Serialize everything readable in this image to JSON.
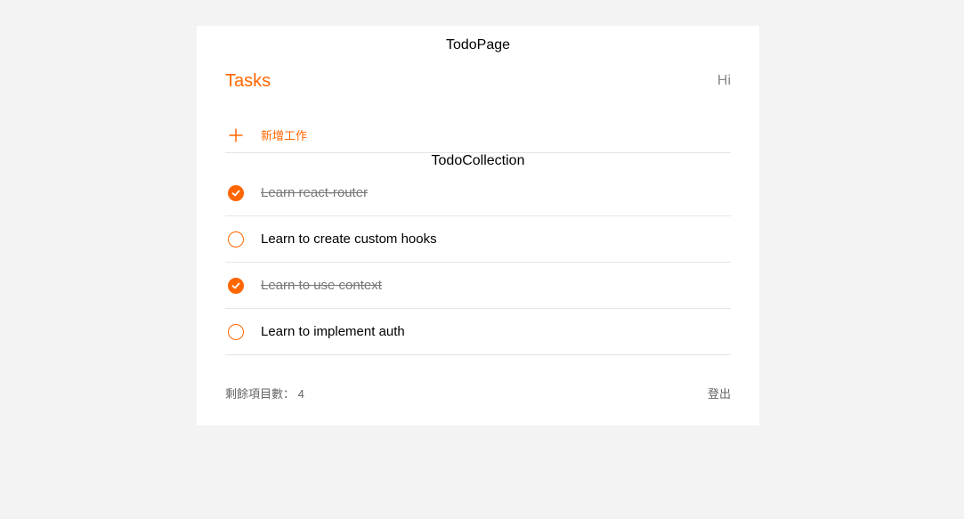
{
  "page": {
    "title": "TodoPage"
  },
  "header": {
    "brand": "Tasks",
    "greeting": "Hi"
  },
  "add_todo": {
    "placeholder": "新增工作"
  },
  "collection": {
    "title": "TodoCollection"
  },
  "todos": [
    {
      "title": "Learn react-router",
      "done": true
    },
    {
      "title": "Learn to create custom hooks",
      "done": false
    },
    {
      "title": "Learn to use context",
      "done": true
    },
    {
      "title": "Learn to implement auth",
      "done": false
    }
  ],
  "footer": {
    "remaining_label": "剩餘項目數：",
    "remaining_count": "4",
    "logout_label": "登出"
  },
  "colors": {
    "accent": "#ff6600",
    "background": "#f3f3f3",
    "card": "#ffffff"
  }
}
